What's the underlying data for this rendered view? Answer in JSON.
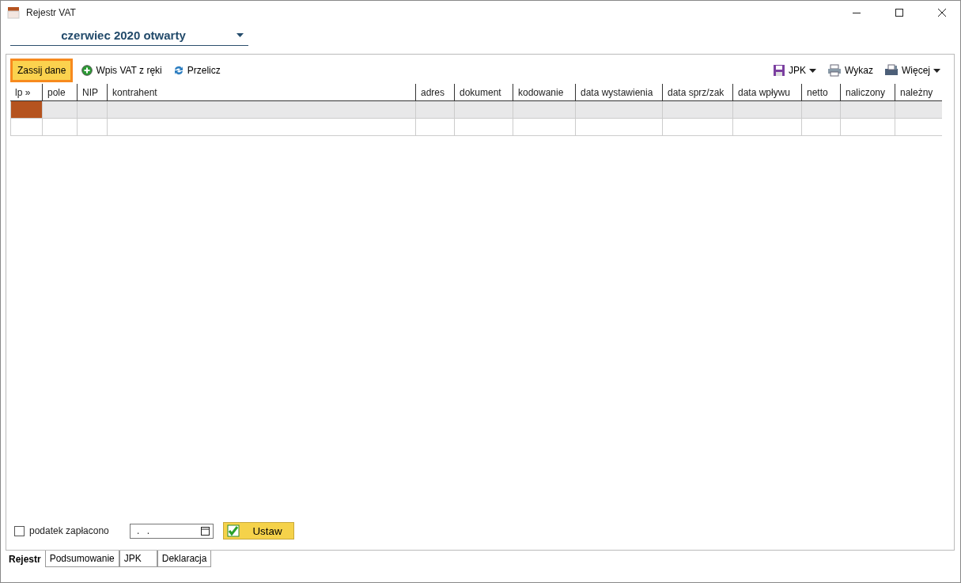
{
  "window": {
    "title": "Rejestr VAT"
  },
  "period": {
    "value": "czerwiec 2020 otwarty"
  },
  "toolbar": {
    "left": [
      {
        "kind": "highlight",
        "label": "Zassij dane"
      },
      {
        "kind": "add",
        "label": "Wpis VAT z ręki"
      },
      {
        "kind": "refresh",
        "label": "Przelicz"
      }
    ],
    "right": [
      {
        "kind": "save",
        "label": "JPK",
        "dropdown": true
      },
      {
        "kind": "print",
        "label": "Wykaz",
        "dropdown": false
      },
      {
        "kind": "more",
        "label": "Więcej",
        "dropdown": true
      }
    ]
  },
  "table": {
    "columns": [
      "lp »",
      "pole",
      "NIP",
      "kontrahent",
      "adres",
      "dokument",
      "kodowanie",
      "data wystawienia",
      "data sprz/zak",
      "data wpływu",
      "netto",
      "naliczony",
      "należny"
    ],
    "rows": [
      {
        "selected": true
      },
      {
        "selected": false
      }
    ]
  },
  "paid": {
    "label": "podatek zapłacono",
    "checked": false
  },
  "date_field": {
    "value": ". ."
  },
  "set_button": {
    "label": "Ustaw"
  },
  "tabs": [
    {
      "label": "Rejestr",
      "selected": true
    },
    {
      "label": "Podsumowanie",
      "selected": false
    },
    {
      "label": "JPK",
      "selected": false
    },
    {
      "label": "Deklaracja",
      "selected": false
    }
  ]
}
